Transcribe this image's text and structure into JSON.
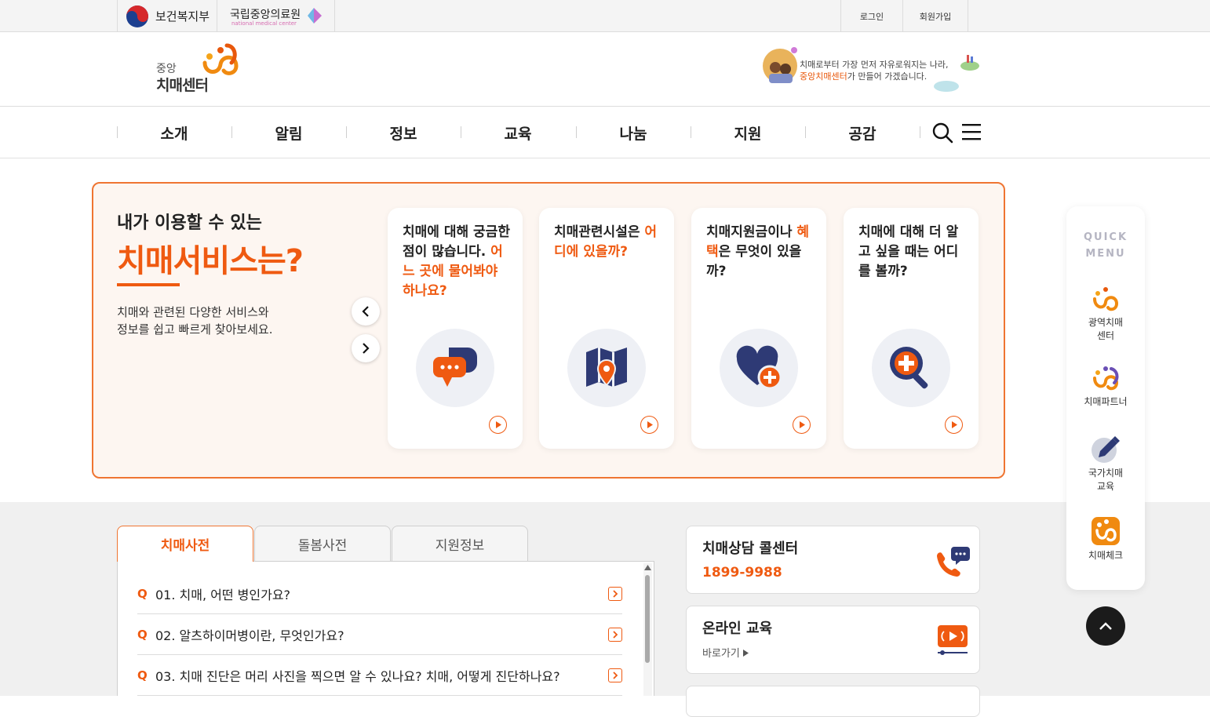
{
  "topbar": {
    "gov_label": "보건복지부",
    "nmc_label": "국립중앙의료원",
    "nmc_sub": "national medical center",
    "login": "로그인",
    "signup": "회원가입"
  },
  "header": {
    "logo_sub": "중앙",
    "logo_main": "치매센터",
    "slogan_line1": "치매로부터 가장 먼저 자유로워지는 나라,",
    "slogan_hl": "중앙치매센터",
    "slogan_line2_rest": "가 만들어 가겠습니다."
  },
  "nav": {
    "items": [
      "소개",
      "알림",
      "정보",
      "교육",
      "나눔",
      "지원",
      "공감"
    ]
  },
  "services": {
    "title_small": "내가 이용할 수 있는",
    "title_big": "치매서비스는?",
    "desc_line1": "치매와 관련된 다양한 서비스와",
    "desc_line2": "정보를 쉽고 빠르게 찾아보세요.",
    "cards": [
      {
        "text_plain": "치매에 대해 궁금한 점이 많습니다. ",
        "text_hl": "어느 곳에 물어봐야 하나요?",
        "text_after": "",
        "icon": "chat-bubble-icon"
      },
      {
        "text_plain": "치매관련시설은 ",
        "text_hl": "어디에 있을까?",
        "text_after": "",
        "icon": "map-pin-icon"
      },
      {
        "text_plain": "치매지원금이나 ",
        "text_hl": "혜택",
        "text_after": "은 무엇이 있을까?",
        "icon": "heart-plus-icon"
      },
      {
        "text_plain": "치매에 대해 더 알고 싶을 때는 어디를 볼까?",
        "text_hl": "",
        "text_after": "",
        "icon": "magnifier-plus-icon"
      }
    ]
  },
  "tabs": {
    "items": [
      "치매사전",
      "돌봄사전",
      "지원정보"
    ],
    "active": "치매사전"
  },
  "faq": {
    "q_mark": "Q",
    "items": [
      "01. 치매, 어떤 병인가요?",
      "02. 알츠하이머병이란, 무엇인가요?",
      "03. 치매 진단은 머리 사진을 찍으면 알 수 있나요? 치매, 어떻게 진단하나요?"
    ]
  },
  "info_cards": {
    "callcenter_title": "치매상담 콜센터",
    "callcenter_phone": "1899-9988",
    "online_title": "온라인 교육",
    "online_link": "바로가기"
  },
  "quick_menu": {
    "title_line1": "QUICK",
    "title_line2": "MENU",
    "items": [
      {
        "line1": "광역치매",
        "line2": "센터"
      },
      {
        "line1": "치매파트너",
        "line2": ""
      },
      {
        "line1": "국가치매",
        "line2": "교육"
      },
      {
        "line1": "치매체크",
        "line2": ""
      }
    ]
  },
  "colors": {
    "accent": "#ef5a11",
    "navy": "#2e3a75",
    "border": "#ef7532"
  }
}
